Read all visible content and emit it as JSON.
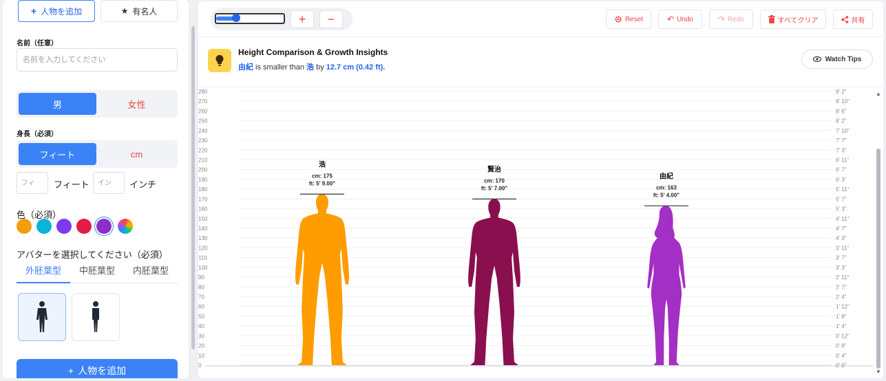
{
  "sidebar": {
    "add_person_label": "人物を追加",
    "celebrity_label": "有名人",
    "name_label": "名前（任意）",
    "name_placeholder": "名前を入力してください",
    "gender": {
      "male": "男",
      "female": "女性"
    },
    "height_label": "身長（必須）",
    "unit_toggle": {
      "feet": "フィート",
      "cm": "cm"
    },
    "feet_placeholder": "フィ",
    "feet_unit": "フィート",
    "inch_placeholder": "イン",
    "inch_unit": "インチ",
    "color_label": "色（必須）",
    "colors": [
      "#f59e0b",
      "#06b6d4",
      "#7c3aed",
      "#e11d48",
      "#8b2fc9"
    ],
    "avatar_label": "アバターを選択してください（必須）",
    "avatar_tabs": [
      "外胚葉型",
      "中胚葉型",
      "内胚葉型"
    ],
    "add_bottom_label": "人物を追加"
  },
  "toolbar": {
    "zoom_level": 0.3,
    "reset": "Reset",
    "undo": "Undo",
    "redo": "Redo",
    "clear_all": "すべてクリア",
    "share": "共有"
  },
  "insight": {
    "title": "Height Comparison & Growth Insights",
    "name_a": "由紀",
    "mid_text": " is smaller than ",
    "name_b": "浩",
    "by_text": " by ",
    "diff": "12.7 cm (0.42 ft).",
    "watch_tips": "Watch Tips"
  },
  "chart_data": {
    "type": "bar",
    "y_cm_ticks": [
      0,
      10,
      20,
      30,
      40,
      50,
      60,
      70,
      80,
      90,
      100,
      110,
      120,
      130,
      140,
      150,
      160,
      170,
      180,
      190,
      200,
      210,
      220,
      230,
      240,
      250,
      260,
      270,
      280
    ],
    "y_ft_ticks": [
      "0' 0\"",
      "0' 4\"",
      "0' 8\"",
      "0' 12\"",
      "1' 4\"",
      "1' 8\"",
      "1' 12\"",
      "2' 4\"",
      "2' 7\"",
      "2' 11\"",
      "3' 3\"",
      "3' 7\"",
      "3' 11\"",
      "4' 3\"",
      "4' 7\"",
      "4' 11\"",
      "5' 3\"",
      "5' 7\"",
      "5' 11\"",
      "6' 3\"",
      "6' 7\"",
      "6' 11\"",
      "7' 3\"",
      "7' 7\"",
      "7' 10\"",
      "8' 2\"",
      "8' 6\"",
      "8' 10\"",
      "9' 2\""
    ],
    "ylim": [
      0,
      280
    ],
    "people": [
      {
        "name": "浩",
        "cm": 175,
        "cm_label": "cm: 175",
        "ft_label": "ft: 5' 9.00\"",
        "color": "#ff9c00",
        "gender": "male"
      },
      {
        "name": "賢治",
        "cm": 170,
        "cm_label": "cm: 170",
        "ft_label": "ft: 5' 7.00\"",
        "color": "#8a0f4e",
        "gender": "male"
      },
      {
        "name": "由紀",
        "cm": 163,
        "cm_label": "cm: 163",
        "ft_label": "ft: 5' 4.00\"",
        "color": "#a42fc4",
        "gender": "female"
      }
    ]
  }
}
